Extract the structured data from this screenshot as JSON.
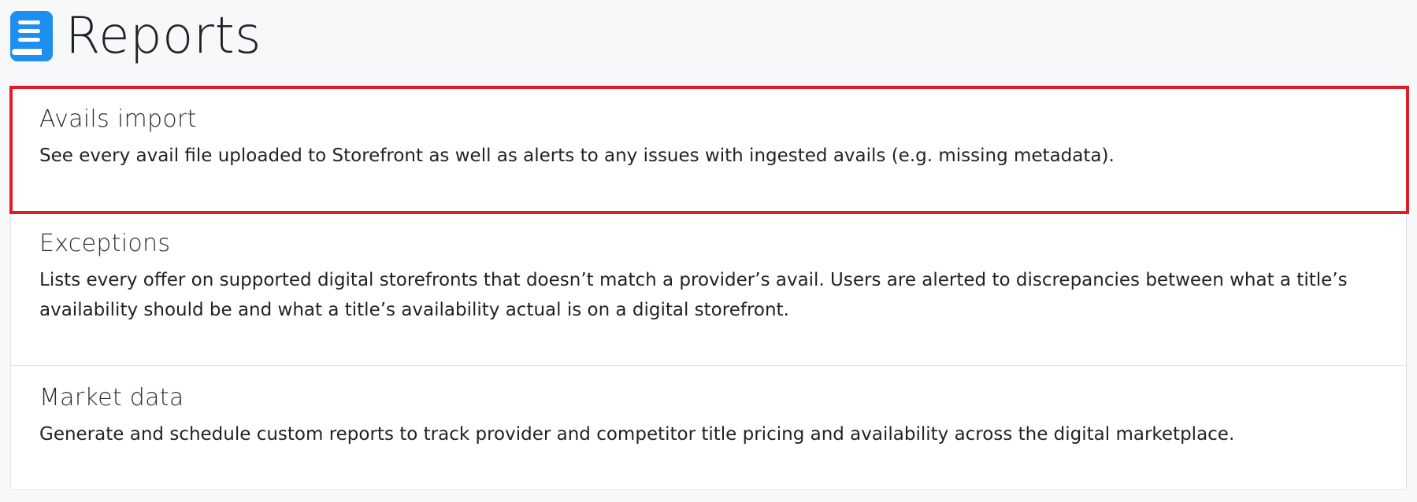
{
  "header": {
    "icon": "book-icon",
    "title": "Reports",
    "accent_color": "#1e8ff0"
  },
  "reports": [
    {
      "title": "Avails import",
      "description": "See every avail file uploaded to Storefront as well as alerts to any issues with ingested avails (e.g. missing metadata)."
    },
    {
      "title": "Exceptions",
      "description": "Lists every offer on supported digital storefronts that doesn’t match a provider’s avail. Users are alerted to discrepancies between what a title’s availability should be and what a title’s availability actual is on a digital storefront."
    },
    {
      "title": "Market data",
      "description": "Generate and schedule custom reports to track provider and competitor title pricing and availability across the digital marketplace."
    }
  ],
  "highlight": {
    "color": "#e01b2c",
    "target": "Avails import"
  }
}
